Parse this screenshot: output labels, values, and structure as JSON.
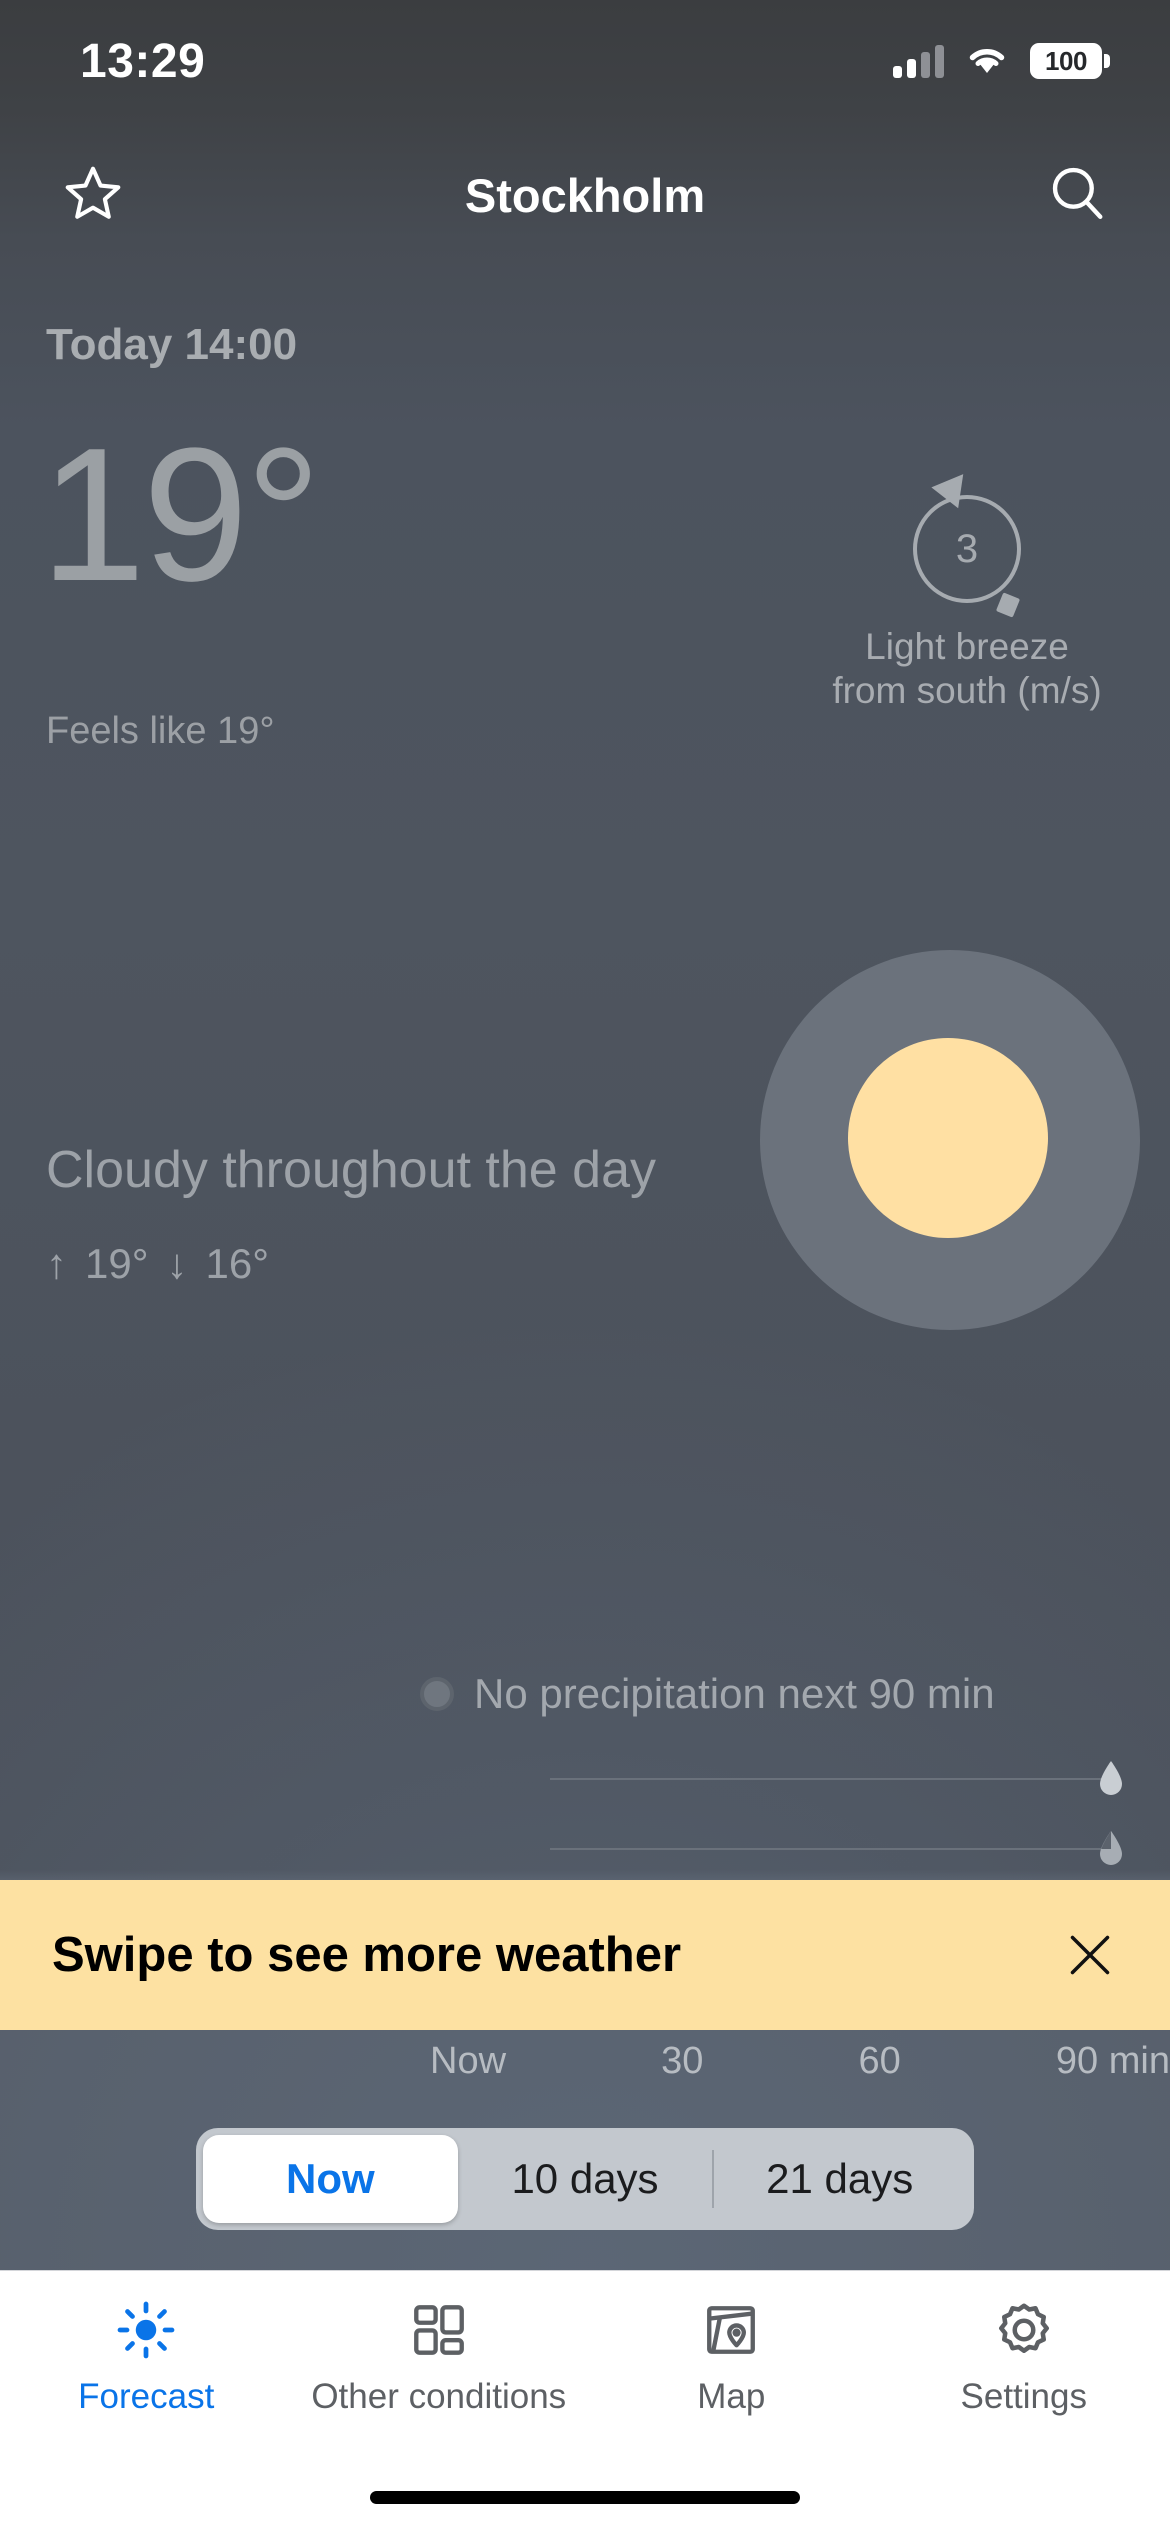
{
  "status_bar": {
    "time": "13:29",
    "battery_percent": "100",
    "signal_icon": "cellular-signal-icon",
    "wifi_icon": "wifi-icon",
    "battery_icon": "battery-icon"
  },
  "header": {
    "favorite_icon": "star-outline-icon",
    "title": "Stockholm",
    "search_icon": "search-icon"
  },
  "now": {
    "time_label": "Today 14:00",
    "temperature": "19°",
    "feels_like": "Feels like 19°"
  },
  "wind": {
    "speed": "3",
    "description": "Light breeze\nfrom south (m/s)",
    "description_line1": "Light breeze",
    "description_line2": "from south (m/s)",
    "dial_icon": "wind-direction-dial-icon"
  },
  "summary": {
    "text": "Cloudy throughout the day",
    "high": "19°",
    "low": "16°",
    "up_arrow": "↑",
    "down_arrow": "↓",
    "cloud_icon": "cloud-circle-icon",
    "sun_icon": "sun-circle-icon"
  },
  "precipitation": {
    "status": "No precipitation next 90 min",
    "status_dot_icon": "precipitation-status-dot-icon",
    "heavy_drop_icon": "filled-raindrop-icon",
    "light_drop_icon": "outlined-raindrop-icon",
    "axis_labels": [
      "Now",
      "30",
      "60",
      "90 min"
    ]
  },
  "banner": {
    "text": "Swipe to see more weather",
    "close_icon": "close-icon",
    "background_color": "#fde1a2"
  },
  "segmented_control": {
    "options": [
      "Now",
      "10 days",
      "21 days"
    ],
    "selected": "Now",
    "selected_color": "#0a74e8"
  },
  "tab_bar": {
    "items": [
      {
        "label": "Forecast",
        "icon": "sun-icon",
        "active": true
      },
      {
        "label": "Other conditions",
        "icon": "grid-icon",
        "active": false
      },
      {
        "label": "Map",
        "icon": "map-pin-icon",
        "active": false
      },
      {
        "label": "Settings",
        "icon": "gear-icon",
        "active": false
      }
    ],
    "active_color": "#0a74e8",
    "inactive_color": "#5d6064"
  }
}
